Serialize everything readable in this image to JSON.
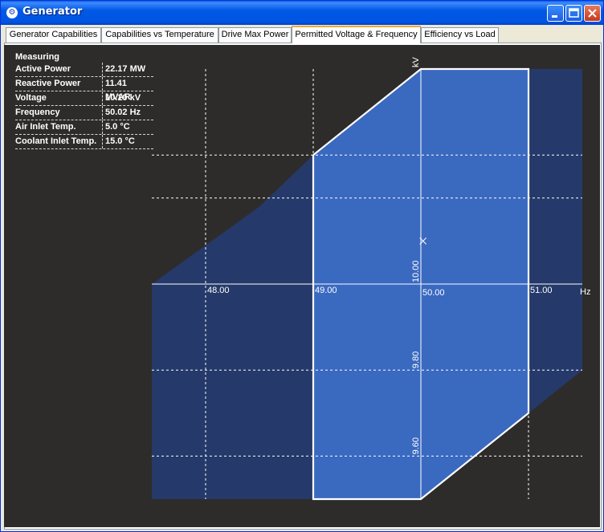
{
  "window": {
    "title": "Generator",
    "icon": "generator-app-icon",
    "controls": [
      "minimize-icon",
      "maximize-icon",
      "close-icon"
    ]
  },
  "tabs": [
    {
      "label": "Generator Capabilities",
      "active": false
    },
    {
      "label": "Capabilities vs Temperature",
      "active": false
    },
    {
      "label": "Drive Max Power",
      "active": false
    },
    {
      "label": "Permitted Voltage & Frequency",
      "active": true
    },
    {
      "label": "Efficiency vs Load",
      "active": false
    }
  ],
  "measuring": {
    "title": "Measuring",
    "rows": [
      {
        "label": "Active Power",
        "value": "22.17 MW"
      },
      {
        "label": "Reactive Power",
        "value": "11.41 MVAR"
      },
      {
        "label": "Voltage",
        "value": "10.10 kV"
      },
      {
        "label": "Frequency",
        "value": "50.02 Hz"
      },
      {
        "label": "Air Inlet Temp.",
        "value": "5.0 °C"
      },
      {
        "label": "Coolant Inlet Temp.",
        "value": "15.0 °C"
      }
    ]
  },
  "chart_data": {
    "type": "area",
    "xlabel": "Hz",
    "ylabel": "kV",
    "x_ticks": [
      {
        "value": 48.0,
        "label": "48.00"
      },
      {
        "value": 49.0,
        "label": "49.00"
      },
      {
        "value": 50.0,
        "label": "50.00"
      },
      {
        "value": 51.0,
        "label": "51.00"
      }
    ],
    "y_ticks": [
      {
        "value": 10.0,
        "label": "10.00"
      },
      {
        "value": 9.8,
        "label": "9.80"
      },
      {
        "value": 9.6,
        "label": "9.60"
      }
    ],
    "xlim": [
      47.5,
      51.5
    ],
    "ylim": [
      9.5,
      10.5
    ],
    "origin": {
      "x": 50.0,
      "y": 10.0
    },
    "grid": true,
    "colors": {
      "background": "#2e2c2b",
      "outer_region": "#253a6a",
      "inner_region": "#3a69c0",
      "boundary": "#ffffff",
      "grid": "#ffffff"
    },
    "outer_region": [
      [
        47.5,
        10.0
      ],
      [
        48.5,
        10.18
      ],
      [
        49.0,
        10.3
      ],
      [
        50.0,
        10.5
      ],
      [
        51.5,
        10.5
      ],
      [
        51.5,
        9.8
      ],
      [
        51.0,
        9.7
      ],
      [
        50.0,
        9.5
      ],
      [
        47.5,
        9.5
      ]
    ],
    "inner_region": [
      [
        49.0,
        10.3
      ],
      [
        50.0,
        10.5
      ],
      [
        51.0,
        10.5
      ],
      [
        51.0,
        9.7
      ],
      [
        50.0,
        9.5
      ],
      [
        49.0,
        9.5
      ]
    ],
    "operating_point": {
      "x": 50.02,
      "y": 10.1
    }
  }
}
